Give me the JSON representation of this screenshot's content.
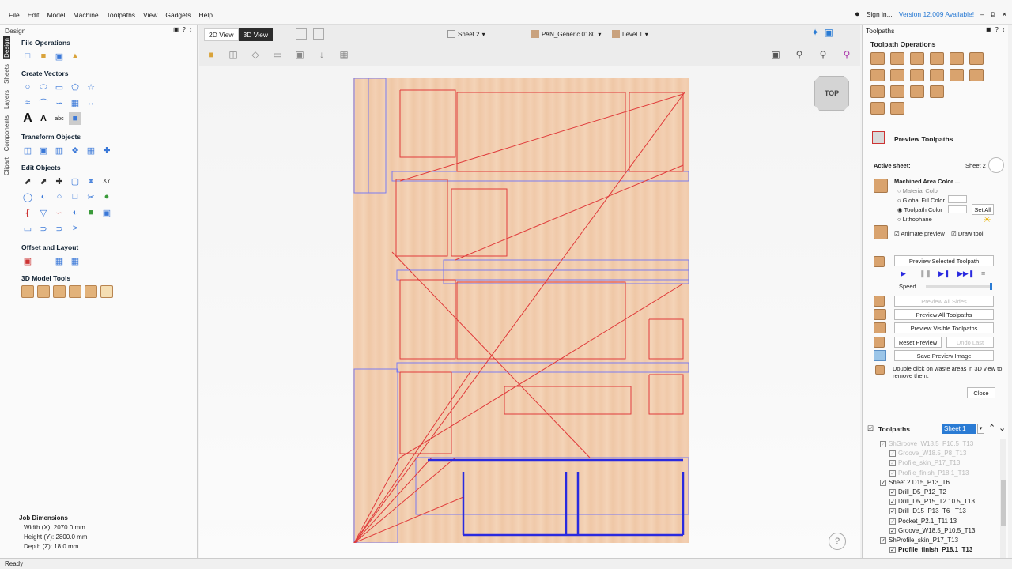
{
  "menu": [
    "File",
    "Edit",
    "Model",
    "Machine",
    "Toolpaths",
    "View",
    "Gadgets",
    "Help"
  ],
  "top_right": {
    "signin": "Sign in...",
    "version": "Version 12.009 Available!"
  },
  "design_panel": {
    "title": "Design",
    "vtabs": [
      "Design",
      "Sheets",
      "Layers",
      "Components",
      "Clipart"
    ],
    "sections": {
      "file_ops": "File Operations",
      "create_vectors": "Create Vectors",
      "transform": "Transform Objects",
      "edit": "Edit Objects",
      "offset": "Offset and Layout",
      "model_tools": "3D Model Tools"
    },
    "job_dimensions": {
      "title": "Job Dimensions",
      "width": "Width  (X): 2070.0 mm",
      "height": "Height (Y): 2800.0 mm",
      "depth": "Depth  (Z): 18.0 mm"
    }
  },
  "view": {
    "tab_2d": "2D View",
    "tab_3d": "3D View",
    "sheet": "Sheet 2",
    "material": "PAN_Generic 0180",
    "level": "Level 1",
    "cube_label": "TOP",
    "help": "?"
  },
  "toolpaths_panel": {
    "title": "Toolpaths",
    "operations_title": "Toolpath Operations",
    "preview_title": "Preview Toolpaths",
    "active_sheet_label": "Active sheet:",
    "active_sheet_value": "Sheet 2",
    "machined_area_color": "Machined Area Color ...",
    "opt_material": "Material Color",
    "opt_global": "Global Fill Color",
    "opt_toolpath": "Toolpath Color",
    "opt_lithophane": "Lithophane",
    "set_all": "Set All",
    "animate_preview": "Animate preview",
    "draw_tool": "Draw tool",
    "preview_selected": "Preview Selected Toolpath",
    "speed": "Speed",
    "preview_all_sides": "Preview All Sides",
    "preview_all": "Preview All Toolpaths",
    "preview_visible": "Preview Visible Toolpaths",
    "reset_preview": "Reset Preview",
    "undo_last": "Undo Last",
    "save_image": "Save Preview Image",
    "hint": "Double click on waste areas in 3D view to remove them.",
    "close": "Close",
    "list_title": "Toolpaths",
    "sheet_select": "Sheet 1",
    "items": [
      {
        "label": "ShGroove_W18.5_P10.5_T13",
        "dim": true
      },
      {
        "label": "Groove_W18.5_P8_T13",
        "dim": true
      },
      {
        "label": "Profile_skin_P17_T13",
        "dim": true
      },
      {
        "label": "Profile_finish_P18.1_T13",
        "dim": true
      },
      {
        "label": "Sheet 2 D15_P13_T6",
        "dim": false
      },
      {
        "label": "Drill_D5_P12_T2",
        "dim": false
      },
      {
        "label": "Drill_D5_P15_T2 10.5_T13",
        "dim": false
      },
      {
        "label": "Drill_D15_P13_T6 _T13",
        "dim": false
      },
      {
        "label": "Pocket_P2.1_T11 13",
        "dim": false
      },
      {
        "label": "Groove_W18.5_P10.5_T13",
        "dim": false
      },
      {
        "label": "ShProfile_skin_P17_T13",
        "dim": false
      },
      {
        "label": "Profile_finish_P18.1_T13",
        "dim": false
      }
    ]
  },
  "status": "Ready"
}
